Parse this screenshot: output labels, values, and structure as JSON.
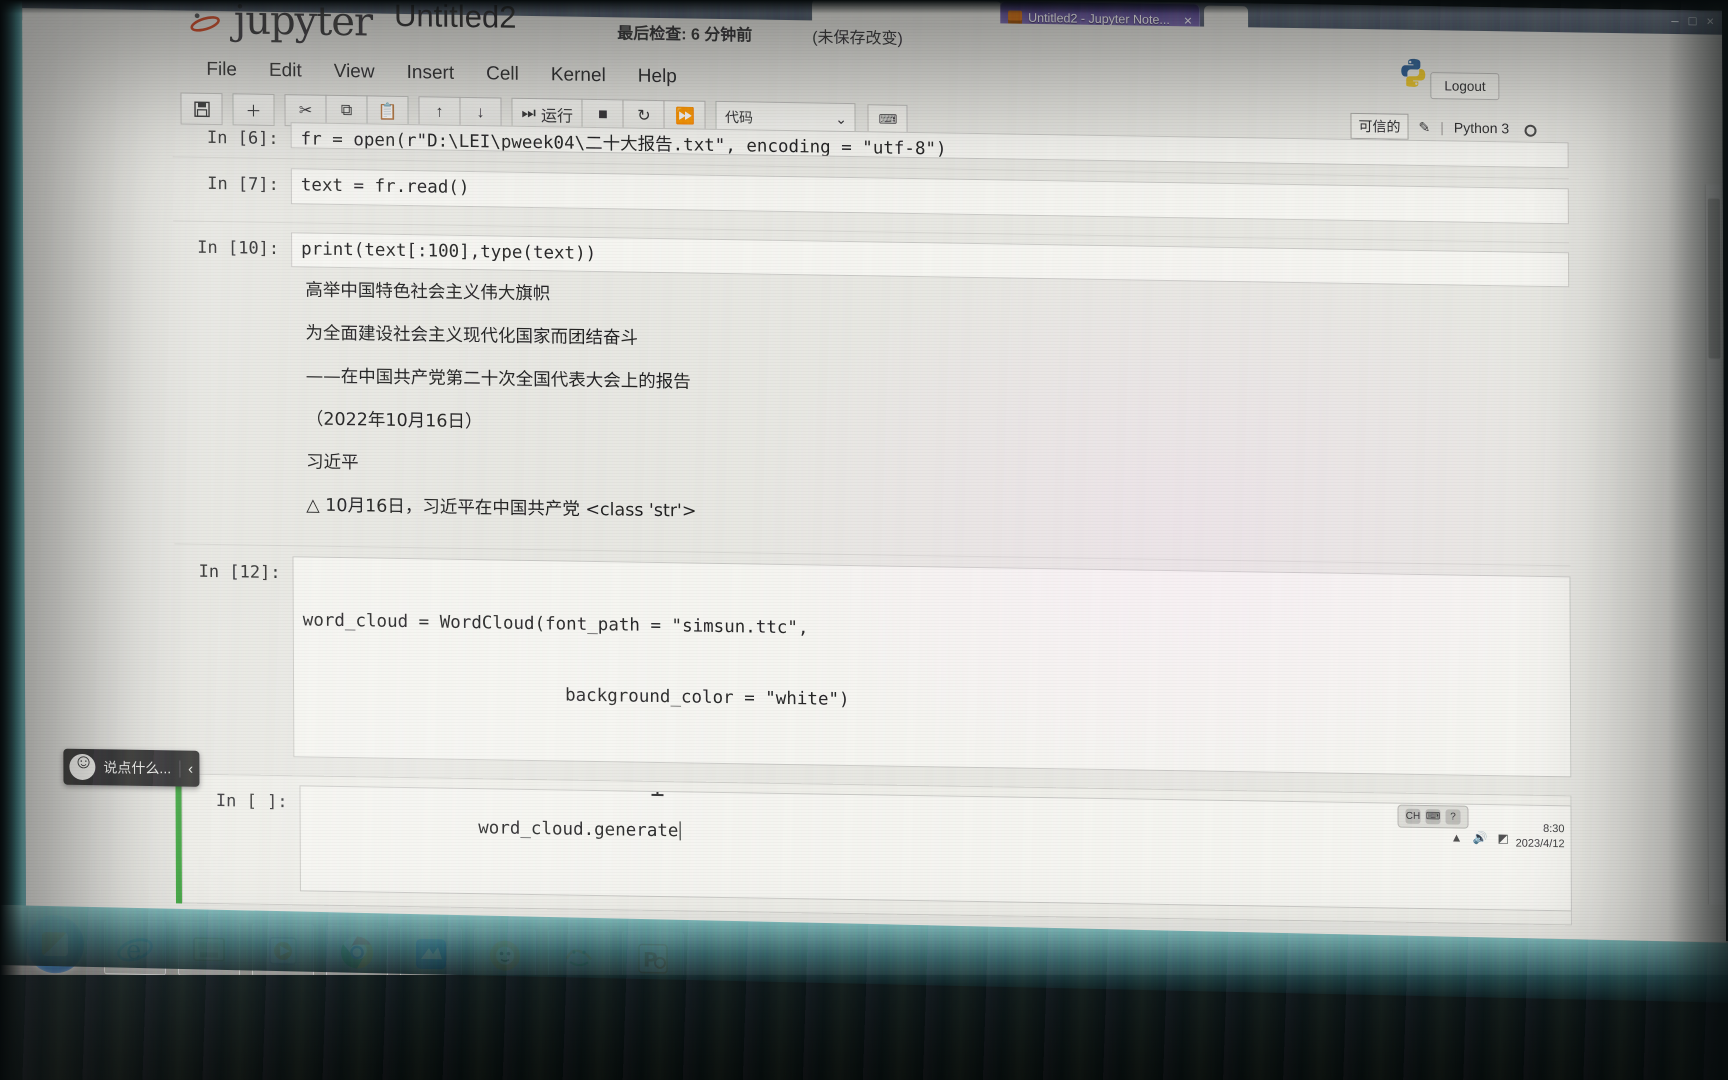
{
  "browser": {
    "tab_title": "Untitled2 - Jupyter Note...",
    "tab_close": "×",
    "minimize": "–",
    "maximize": "□",
    "close": "×",
    "home_icon": "⌂",
    "favorites_icon": "★",
    "tools_icon": "⚙"
  },
  "header": {
    "logo": "jupyter",
    "notebook_name": "Untitled2",
    "checkpoint": "最后检查: 6 分钟前",
    "dirty_flag": "(未保存改变)",
    "logout": "Logout"
  },
  "menubar": {
    "items": [
      {
        "label": "File"
      },
      {
        "label": "Edit"
      },
      {
        "label": "View"
      },
      {
        "label": "Insert"
      },
      {
        "label": "Cell"
      },
      {
        "label": "Kernel"
      },
      {
        "label": "Help"
      }
    ]
  },
  "toolbar": {
    "save_icon": "💾",
    "insert_icon": "＋",
    "cut_icon": "✂",
    "copy_icon": "⧉",
    "paste_icon": "📋",
    "move_up_icon": "↑",
    "move_down_icon": "↓",
    "run_icon": "⏭",
    "run_label": "运行",
    "stop_icon": "■",
    "restart_icon": "↻",
    "restart_run_all_icon": "⏩",
    "cell_type_value": "代码",
    "cell_type_caret": "⌄",
    "command_palette_icon": "⌨"
  },
  "status": {
    "trusted": "可信的",
    "edit_mode_icon": "✎",
    "separator": "|",
    "kernel": "Python 3",
    "kernel_state_icon": "idle-circle-icon"
  },
  "notebook": {
    "cells": [
      {
        "prompt": "In [6]:",
        "source": "fr = open(r\"D:\\LEI\\pweek04\\二十大报告.txt\", encoding = \"utf-8\")",
        "clipped": true
      },
      {
        "prompt": "In [7]:",
        "source": "text = fr.read()"
      },
      {
        "prompt": "In [10]:",
        "source": "print(text[:100],type(text))",
        "output_lines": [
          "高举中国特色社会主义伟大旗帜",
          "为全面建设社会主义现代化国家而团结奋斗",
          "——在中国共产党第二十次全国代表大会上的报告",
          "（2022年10月16日）",
          "习近平",
          "",
          "△  10月16日，习近平在中国共产党 <class 'str'>"
        ]
      },
      {
        "prompt": "In [12]:",
        "source_line1": "word_cloud = WordCloud(font_path = \"simsun.ttc\",",
        "source_line2": "background_color = \"white\")"
      },
      {
        "prompt": "In [ ]:",
        "source": "word_cloud.generate",
        "selected": true,
        "cursor": true
      }
    ]
  },
  "chat_widget": {
    "face_icon": "smiley-icon",
    "placeholder": "说点什么...",
    "collapse_icon": "‹"
  },
  "tray": {
    "items": [
      "CH",
      "⌨",
      "?"
    ],
    "expand_icon": "▲",
    "time": "8:30",
    "date": "2023/4/12",
    "speaker_icon": "🔊",
    "network_icon": "◩"
  },
  "taskbar": {
    "start_label": "start-orb",
    "items": [
      {
        "name": "internet-explorer-icon"
      },
      {
        "name": "file-explorer-icon"
      },
      {
        "name": "media-player-icon"
      },
      {
        "name": "google-chrome-icon"
      },
      {
        "name": "xunlei-icon"
      },
      {
        "name": "sogou-icon"
      },
      {
        "name": "anaconda-icon"
      },
      {
        "name": "powerpoint-icon"
      }
    ]
  },
  "colors": {
    "jupyter_orange": "#f37726",
    "cell_selected_green": "#3aa33a",
    "prompt_text": "#303030",
    "code_operator": "#7a2ac0",
    "page_bg": "#e7e7e1"
  }
}
